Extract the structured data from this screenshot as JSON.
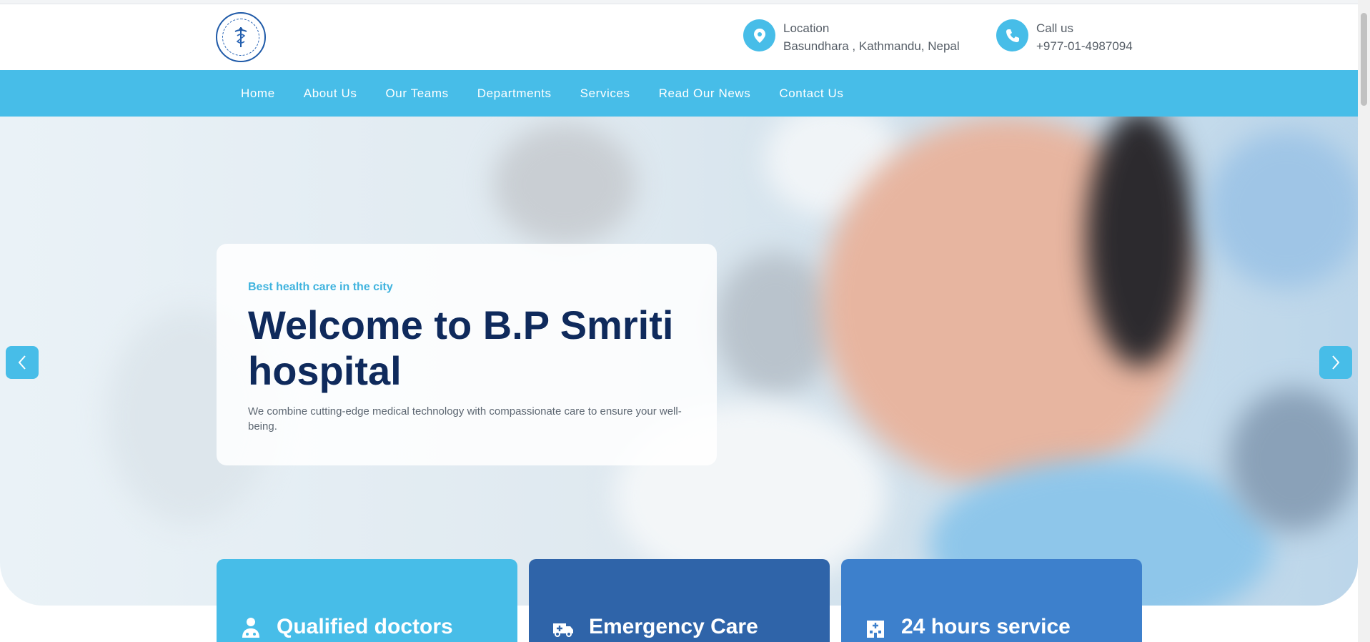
{
  "header": {
    "location_label": "Location",
    "location_value": "Basundhara , Kathmandu, Nepal",
    "call_label": "Call us",
    "call_value": "+977-01-4987094"
  },
  "nav": {
    "items": [
      "Home",
      "About Us",
      "Our Teams",
      "Departments",
      "Services",
      "Read Our News",
      "Contact Us"
    ]
  },
  "hero": {
    "kicker": "Best health care in the city",
    "title": "Welcome to B.P Smriti hospital",
    "description": "We combine cutting-edge medical technology with compassionate care to ensure your well-being."
  },
  "features": [
    {
      "title": "Qualified doctors",
      "icon": "doctor-icon"
    },
    {
      "title": "Emergency Care",
      "icon": "ambulance-icon"
    },
    {
      "title": "24 hours service",
      "icon": "hospital-icon"
    }
  ],
  "colors": {
    "primary": "#47bde8",
    "navy": "#0f2a5c",
    "feature_1": "#47bde8",
    "feature_2": "#2f64a9",
    "feature_3": "#3d80cc"
  }
}
